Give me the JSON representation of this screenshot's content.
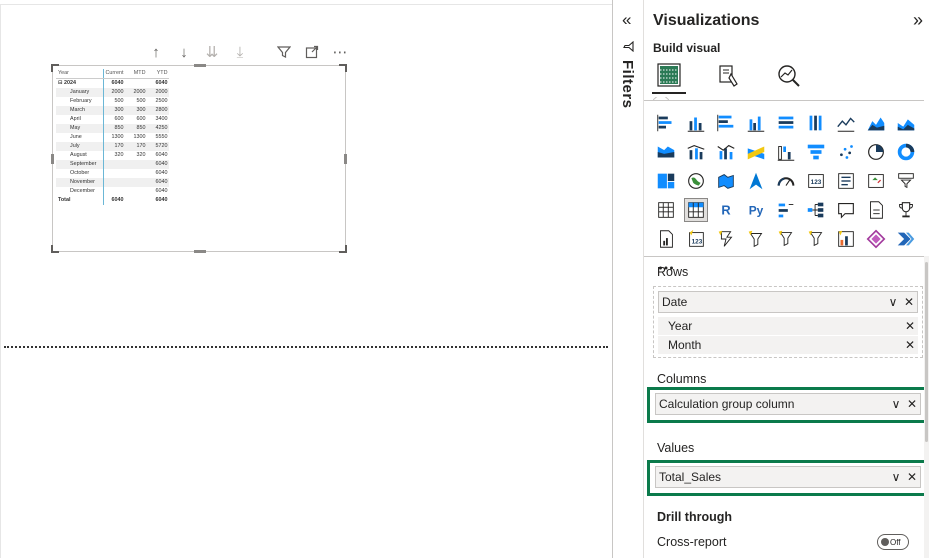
{
  "visual_toolbar": {
    "up": "↑",
    "down": "↓",
    "drill_all": "⇊",
    "expand": "⤓",
    "filter": "⊽",
    "focus": "⤢",
    "more": "⋯"
  },
  "matrix": {
    "headers": [
      "Year",
      "Current",
      "MTD",
      "YTD"
    ],
    "rows": [
      {
        "label": "⊟ 2024",
        "current": "6040",
        "mtd": "",
        "ytd": "6040",
        "bold": true
      },
      {
        "label": "January",
        "current": "2000",
        "mtd": "2000",
        "ytd": "2000"
      },
      {
        "label": "February",
        "current": "500",
        "mtd": "500",
        "ytd": "2500"
      },
      {
        "label": "March",
        "current": "300",
        "mtd": "300",
        "ytd": "2800"
      },
      {
        "label": "April",
        "current": "600",
        "mtd": "600",
        "ytd": "3400"
      },
      {
        "label": "May",
        "current": "850",
        "mtd": "850",
        "ytd": "4250"
      },
      {
        "label": "June",
        "current": "1300",
        "mtd": "1300",
        "ytd": "5550"
      },
      {
        "label": "July",
        "current": "170",
        "mtd": "170",
        "ytd": "5720"
      },
      {
        "label": "August",
        "current": "320",
        "mtd": "320",
        "ytd": "6040"
      },
      {
        "label": "September",
        "current": "",
        "mtd": "",
        "ytd": "6040"
      },
      {
        "label": "October",
        "current": "",
        "mtd": "",
        "ytd": "6040"
      },
      {
        "label": "November",
        "current": "",
        "mtd": "",
        "ytd": "6040"
      },
      {
        "label": "December",
        "current": "",
        "mtd": "",
        "ytd": "6040"
      },
      {
        "label": "Total",
        "current": "6040",
        "mtd": "",
        "ytd": "6040",
        "bold": true
      }
    ]
  },
  "filters": {
    "label": "Filters",
    "collapse": "«",
    "funnel": "⊲"
  },
  "viz": {
    "title": "Visualizations",
    "expand": "»",
    "build_label": "Build visual",
    "rows_label": "Rows",
    "rows_field": "Date",
    "rows_subfields": [
      "Year",
      "Month"
    ],
    "columns_label": "Columns",
    "columns_field": "Calculation group column",
    "values_label": "Values",
    "values_field": "Total_Sales",
    "drill_label": "Drill through",
    "cross_report_label": "Cross-report",
    "toggle_label": "Off",
    "chev": "∨",
    "x": "✕"
  },
  "colors": {
    "highlight": "#0b7a4b",
    "accent_blue": "#118dff",
    "yellow": "#f2c811",
    "dark_blue": "#1a3b5c"
  }
}
